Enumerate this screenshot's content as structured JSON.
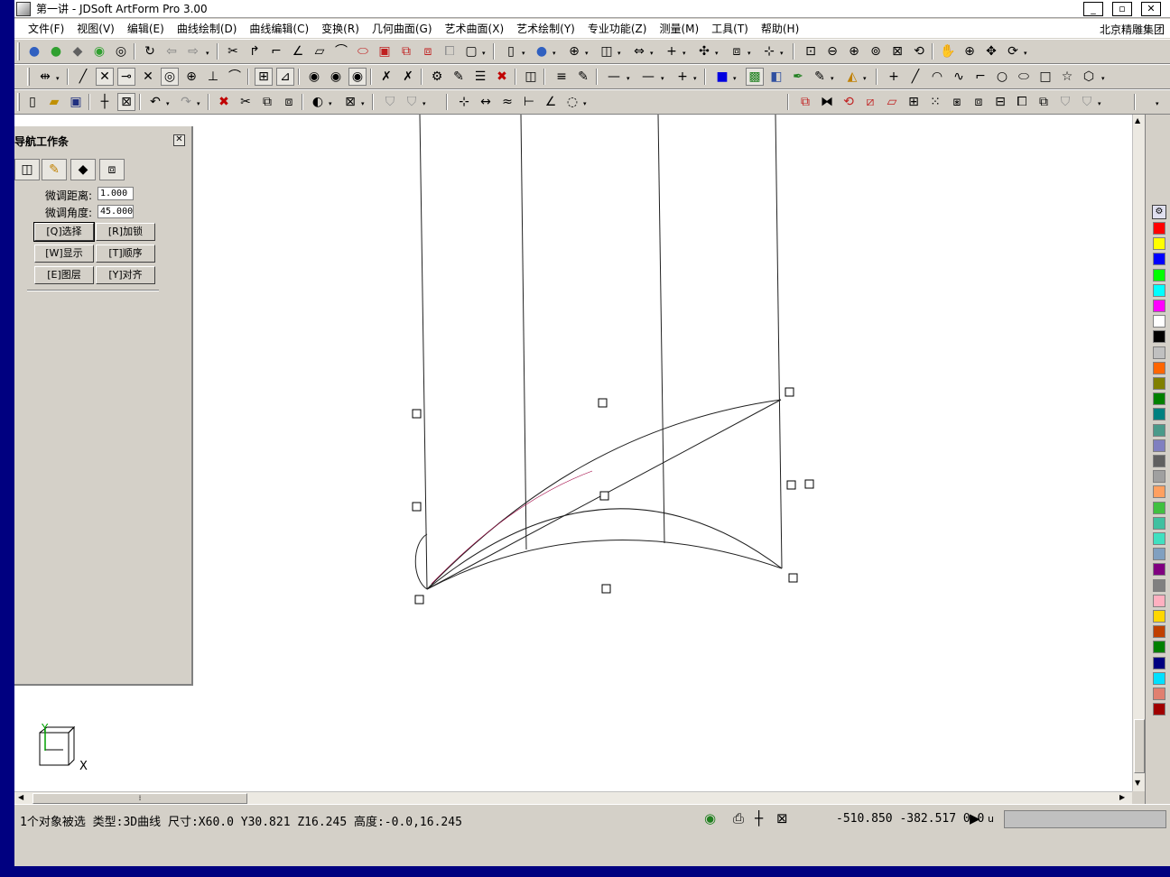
{
  "window": {
    "title": "第一讲 - JDSoft ArtForm Pro 3.00",
    "min_label": "_",
    "max_label": "▫",
    "close_label": "✕"
  },
  "menubar": {
    "items": [
      "文件(F)",
      "视图(V)",
      "编辑(E)",
      "曲线绘制(D)",
      "曲线编辑(C)",
      "变换(R)",
      "几何曲面(G)",
      "艺术曲面(X)",
      "艺术绘制(Y)",
      "专业功能(Z)",
      "测量(M)",
      "工具(T)",
      "帮助(H)"
    ],
    "brand": "北京精雕集团"
  },
  "nav_panel": {
    "title": "导航工作条",
    "close_label": "✕",
    "label_distance": "微调距离:",
    "value_distance": "1.000",
    "label_angle": "微调角度:",
    "value_angle": "45.000",
    "buttons": [
      "[Q]选择",
      "[R]加锁",
      "[W]显示",
      "[T]顺序",
      "[E]图层",
      "[Y]对齐"
    ]
  },
  "status": {
    "info": "1个对象被选 类型:3D曲线 尺寸:X60.0 Y30.821 Z16.245 高度:-0.0,16.245",
    "coords": "-510.850 -382.517 0.0",
    "unit": "u"
  },
  "axis": {
    "x_label": "X",
    "y_label": "Y"
  },
  "palette": {
    "colors": [
      "#ff0000",
      "#ffff00",
      "#0000ff",
      "#00ff00",
      "#00ffff",
      "#ff00ff",
      "#ffffff",
      "#000000",
      "#c0c0c0",
      "#ff6600",
      "#808000",
      "#008000",
      "#008080",
      "#4a9a8a",
      "#8080c0",
      "#606060",
      "#a0a0a0",
      "#ffa060",
      "#40c040",
      "#40c0a0",
      "#40e0c0",
      "#80a0c0",
      "#800080",
      "#808080",
      "#ffb0c0",
      "#ffd700",
      "#c04000",
      "#008000",
      "#000080",
      "#00e0ff",
      "#e08070",
      "#a00000"
    ]
  }
}
